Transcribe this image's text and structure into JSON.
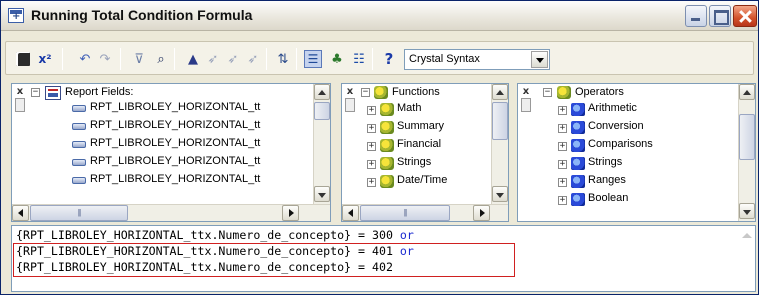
{
  "window": {
    "title": "Running Total Condition Formula"
  },
  "toolbar": {
    "syntax_selected": "Crystal Syntax",
    "icons": [
      "save-icon",
      "check-icon",
      "undo-icon",
      "redo-icon",
      "bookmark-icon",
      "find-icon",
      "bookmark-next-icon",
      "bookmark-prev-icon",
      "bookmark-clear-icon",
      "bookmark-all-icon",
      "sort-icon",
      "tree-view-icon",
      "field-tree-icon",
      "function-tree-icon",
      "help-icon"
    ]
  },
  "fields_pane": {
    "root_label": "Report Fields:",
    "items": [
      "RPT_LIBROLEY_HORIZONTAL_tt",
      "RPT_LIBROLEY_HORIZONTAL_tt",
      "RPT_LIBROLEY_HORIZONTAL_tt",
      "RPT_LIBROLEY_HORIZONTAL_tt",
      "RPT_LIBROLEY_HORIZONTAL_tt"
    ]
  },
  "functions_pane": {
    "root_label": "Functions",
    "items": [
      "Math",
      "Summary",
      "Financial",
      "Strings",
      "Date/Time"
    ]
  },
  "operators_pane": {
    "root_label": "Operators",
    "items": [
      "Arithmetic",
      "Conversion",
      "Comparisons",
      "Strings",
      "Ranges",
      "Boolean"
    ]
  },
  "editor": {
    "lines": [
      {
        "expr": "{RPT_LIBROLEY_HORIZONTAL_ttx.Numero_de_concepto} = 300 ",
        "keyword": "or"
      },
      {
        "expr": "{RPT_LIBROLEY_HORIZONTAL_ttx.Numero_de_concepto} = 401 ",
        "keyword": "or"
      },
      {
        "expr": "{RPT_LIBROLEY_HORIZONTAL_ttx.Numero_de_concepto} = 402",
        "keyword": ""
      }
    ]
  },
  "colors": {
    "keyword": "#1a2ad0",
    "highlight_border": "#d02020",
    "title_bar": "#e9e6dc",
    "close_button": "#d2522b"
  }
}
